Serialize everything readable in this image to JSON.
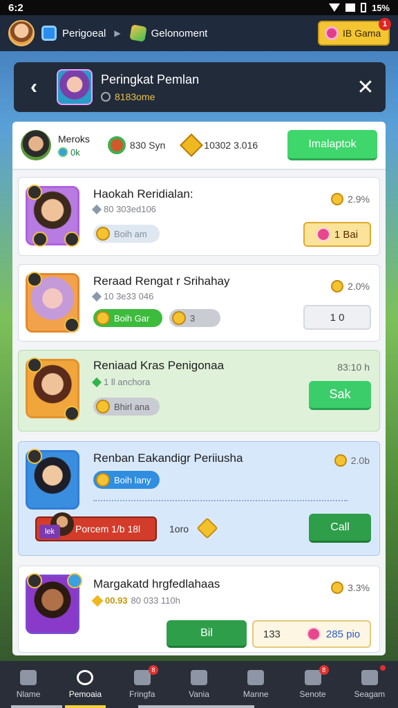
{
  "statusbar": {
    "time": "6:2",
    "battery": "15%"
  },
  "topbar": {
    "item1_label": "Perigoeal",
    "item2_label": "Gelonoment",
    "gems_label": "IB Gama",
    "gems_badge": "1"
  },
  "dialog": {
    "title": "Peringkat Pemlan",
    "subtitle": "8183ome",
    "back_symbol": "‹",
    "close_symbol": "✕"
  },
  "summary": {
    "name": "Meroks",
    "level": "0k",
    "stat1": "830 Syn",
    "stat2": "10302 3.016",
    "cta_label": "Imalaptok"
  },
  "cards": [
    {
      "name": "Haokah Reridialan:",
      "sub": "80 303ed106",
      "pct": "2.9%",
      "chip": "Boih am",
      "button": "1 Bai"
    },
    {
      "name": "Reraad Rengat r Srihahay",
      "sub": "10 3e33 046",
      "pct": "2.0%",
      "chip": "Boih Gar",
      "mini": "3",
      "button": "1 0"
    },
    {
      "name": "Reniaad Kras Penigonaa",
      "sub": "1 ll anchora",
      "pct": "83:10 h",
      "chip": "Bhirl ana",
      "button": "Sak"
    },
    {
      "name": "Renban Eakandigr Periiusha",
      "pct": "2.0b",
      "chip": "Boih lany",
      "pill": "Porcem 1/b 18l",
      "pill_tag": "lek",
      "mid": "1oro",
      "button": "Call"
    },
    {
      "name": "Margakatd hrgfedlahaas",
      "sub_value": "00.93",
      "sub": "80 033 110h",
      "pct": "3.3%",
      "button1": "Bil",
      "button2_left": "133",
      "button2_right": "285 pio"
    }
  ],
  "bottomnav": [
    {
      "label": "Nlame",
      "icon": "home-icon"
    },
    {
      "label": "Pemoaia",
      "icon": "search-icon"
    },
    {
      "label": "Fringfa",
      "icon": "people-icon",
      "badge": "8"
    },
    {
      "label": "Vania",
      "icon": "news-icon"
    },
    {
      "label": "Manne",
      "icon": "leaf-icon"
    },
    {
      "label": "Senote",
      "icon": "store-icon",
      "badge": "8"
    },
    {
      "label": "Seagam",
      "icon": "gift-icon",
      "badge": ""
    }
  ],
  "colors": {
    "accent_green": "#3fd66b",
    "panel_bg": "#f2f4f6",
    "header_bg": "#222b3a",
    "nav_bg": "#2a2e38"
  }
}
